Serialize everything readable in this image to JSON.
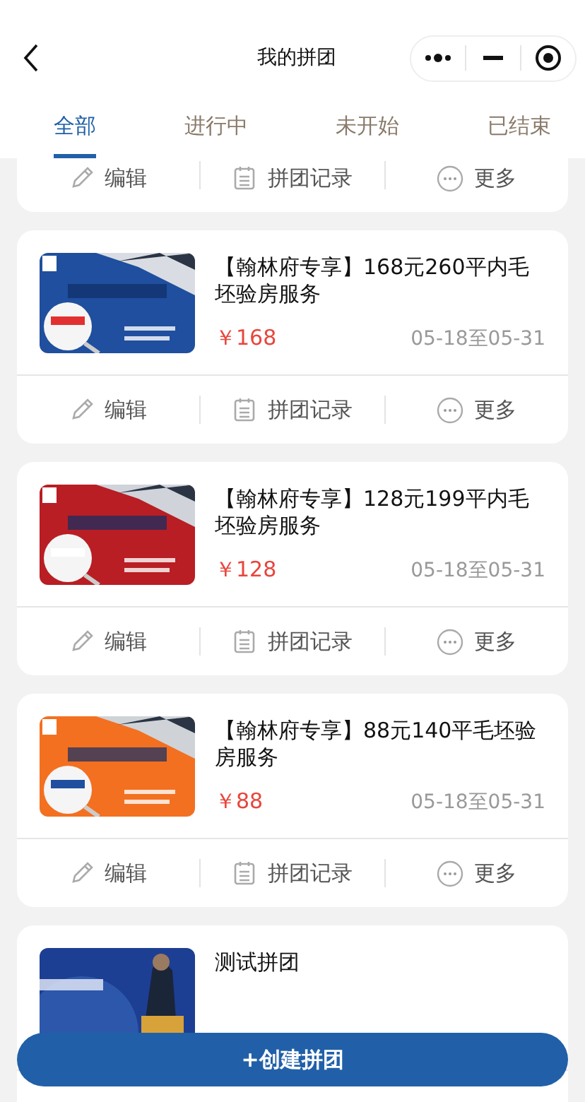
{
  "header": {
    "title": "我的拼团"
  },
  "tabs": [
    {
      "label": "全部",
      "selected": true
    },
    {
      "label": "进行中",
      "selected": false
    },
    {
      "label": "未开始",
      "selected": false
    },
    {
      "label": "已结束",
      "selected": false
    }
  ],
  "deals": [
    {
      "actions": [
        {
          "kind": "edit",
          "label": "编辑"
        },
        {
          "kind": "records",
          "label": "拼团记录"
        },
        {
          "kind": "more",
          "label": "更多"
        }
      ]
    },
    {
      "title": "【翰林府专享】168元260平内毛坯验房服务",
      "price": "￥168",
      "dates": "05-18至05-31",
      "image": {
        "kind": "picture"
      },
      "actions": [
        {
          "kind": "edit",
          "label": "编辑"
        },
        {
          "kind": "records",
          "label": "拼团记录"
        },
        {
          "kind": "more",
          "label": "更多"
        }
      ]
    },
    {
      "title": "【翰林府专享】128元199平内毛坯验房服务",
      "price": "￥128",
      "dates": "05-18至05-31",
      "image": {
        "kind": "picture"
      },
      "actions": [
        {
          "kind": "edit",
          "label": "编辑"
        },
        {
          "kind": "records",
          "label": "拼团记录"
        },
        {
          "kind": "more",
          "label": "更多"
        }
      ]
    },
    {
      "title": "【翰林府专享】88元140平毛坯验房服务",
      "price": "￥88",
      "dates": "05-18至05-31",
      "image": {
        "kind": "picture"
      },
      "actions": [
        {
          "kind": "edit",
          "label": "编辑"
        },
        {
          "kind": "records",
          "label": "拼团记录"
        },
        {
          "kind": "more",
          "label": "更多"
        }
      ]
    },
    {
      "title": "测试拼团",
      "image": {
        "kind": "picture"
      }
    }
  ],
  "create_button": {
    "label": "+创建拼团"
  }
}
